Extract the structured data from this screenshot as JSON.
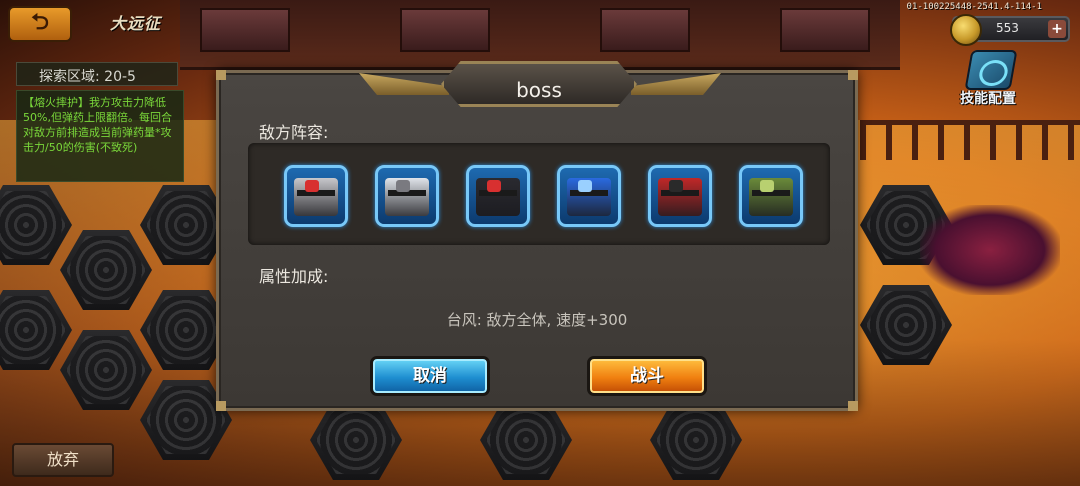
{
  "header": {
    "back_icon": "back-arrow-icon",
    "stage_title": "大远征",
    "version": "01-100225448-2541.4-114-1",
    "currency": {
      "icon": "coin-icon",
      "value": "553",
      "plus": "+"
    },
    "skill_config": {
      "icon": "skill-chip-icon",
      "label": "技能配置"
    }
  },
  "left_panel": {
    "area": "探索区域: 20-5",
    "effect": "【熔火摔护】我方攻击力降低50%,但弹药上限翻倍。每回合对敌方前排造成当前弹药量*攻击力/50的伤害(不致死)"
  },
  "giveup_label": "放弃",
  "modal": {
    "title": "boss",
    "lineup_label": "敌方阵容:",
    "enemies": [
      {
        "name": "red-white-mech",
        "color": "#c8c8cc",
        "accent": "#d83030"
      },
      {
        "name": "white-tiger-mech",
        "color": "#e0e4ea",
        "accent": "#7a7a80"
      },
      {
        "name": "black-red-mech",
        "color": "#2a2a30",
        "accent": "#d83030"
      },
      {
        "name": "blue-mech",
        "color": "#2a6ae0",
        "accent": "#9ad0ff"
      },
      {
        "name": "red-black-mech",
        "color": "#c02828",
        "accent": "#2a2a2a"
      },
      {
        "name": "green-tank-mech",
        "color": "#6a8a3a",
        "accent": "#b8d070"
      }
    ],
    "bonus_label": "属性加成:",
    "bonus_text": "台风: 敌方全体, 速度+300",
    "cancel_label": "取消",
    "fight_label": "战斗"
  }
}
